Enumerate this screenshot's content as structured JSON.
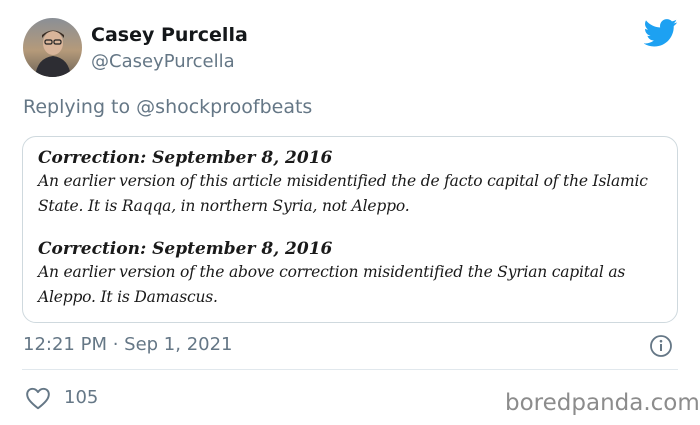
{
  "author": {
    "display_name": "Casey Purcella",
    "handle": "@CaseyPurcella"
  },
  "reply": {
    "prefix": "Replying to",
    "mention": "@shockproofbeats"
  },
  "corrections": [
    {
      "heading": "Correction: September 8, 2016",
      "line1": "An earlier version of this article misidentified the de facto capital of the Islamic",
      "line2": "State. It is Raqqa, in northern Syria, not Aleppo."
    },
    {
      "heading": "Correction: September 8, 2016",
      "line1": "An earlier version of the above correction misidentified the Syrian capital as",
      "line2": "Aleppo. It is Damascus."
    }
  ],
  "timestamp": "12:21 PM · Sep 1, 2021",
  "likes": "105",
  "watermark": "boredpanda.com",
  "icons": {
    "brand": "twitter-bird-icon",
    "info": "info-icon",
    "like": "heart-icon"
  },
  "colors": {
    "twitter_blue": "#1da1f2",
    "secondary_text": "#657786",
    "border": "#cfd9de"
  }
}
